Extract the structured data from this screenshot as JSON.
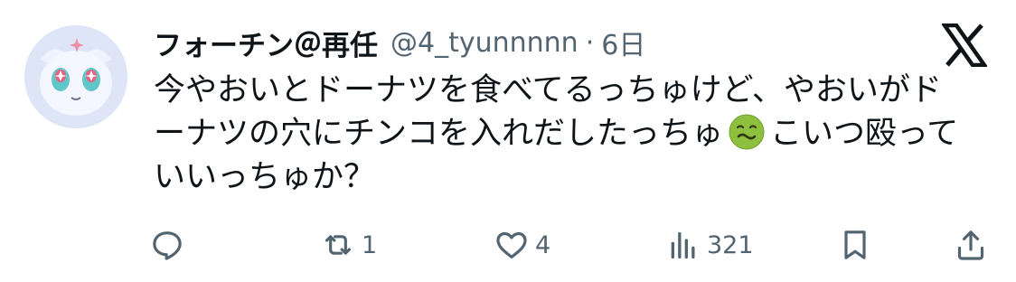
{
  "tweet": {
    "display_name": "フォーチン＠再任",
    "handle": "@4_tyunnnnn",
    "separator": "·",
    "time": "6日",
    "text_lines": [
      "今やおいとドーナツを食べてるっちゅけど、やおいがド",
      "ーナツの穴にチンコを入れだしたっちゅ",
      "こいつ殴って",
      "いいっちゅか？"
    ],
    "emoji": "nauseated-face"
  },
  "actions": {
    "reply_count": "",
    "retweet_count": "1",
    "like_count": "4",
    "views_count": "321"
  },
  "icons": {
    "reply": "reply-icon",
    "retweet": "retweet-icon",
    "like": "heart-icon",
    "views": "views-icon",
    "bookmark": "bookmark-icon",
    "share": "share-icon",
    "brand": "x-logo-icon"
  },
  "colors": {
    "text": "#0f1419",
    "secondary": "#536471",
    "emoji_green": "#8fbf3f"
  }
}
